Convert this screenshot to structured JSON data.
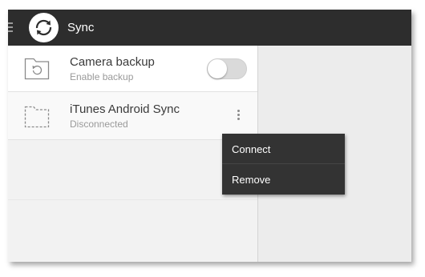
{
  "header": {
    "title": "Sync",
    "menu_icon": "hamburger-icon",
    "logo_icon": "sync-logo-icon",
    "background_color": "#2d2d2d"
  },
  "list": {
    "items": [
      {
        "title": "Camera backup",
        "subtitle": "Enable backup",
        "icon": "camera-backup-folder-icon",
        "toggle": {
          "on": false
        }
      },
      {
        "title": "iTunes Android Sync",
        "subtitle": "Disconnected",
        "icon": "dashed-folder-icon",
        "more_icon": "overflow-menu-icon"
      }
    ]
  },
  "popup_menu": {
    "items": [
      {
        "label": "Connect"
      },
      {
        "label": "Remove"
      }
    ],
    "background_color": "#333333"
  }
}
